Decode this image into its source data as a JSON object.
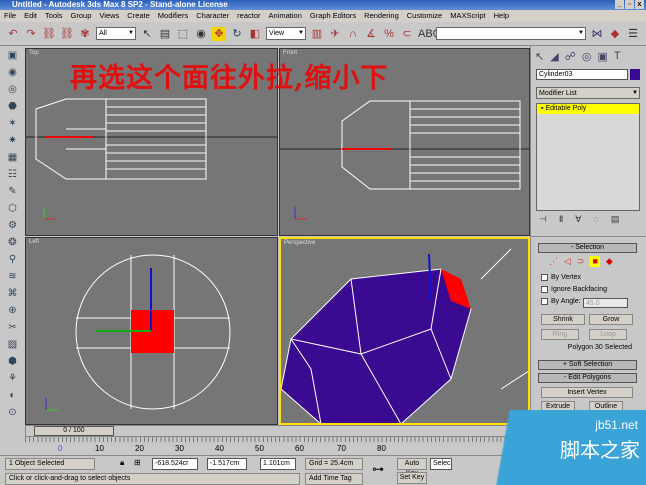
{
  "title": "Untitled - Autodesk 3ds Max 8 SP2  - Stand-alone License",
  "window_controls": [
    "_",
    "▫",
    "x"
  ],
  "menu": [
    "File",
    "Edit",
    "Tools",
    "Group",
    "Views",
    "Create",
    "Modifiers",
    "Character",
    "reactor",
    "Animation",
    "Graph Editors",
    "Rendering",
    "Customize",
    "MAXScript",
    "Help"
  ],
  "toolbar": {
    "selection_filter": "All",
    "ref_coord": "View",
    "named_selection": ""
  },
  "viewports": {
    "top": "Top",
    "front": "Front",
    "left": "Left",
    "perspective": "Perspective"
  },
  "overlay_text": "再选这个面往外拉,缩小下",
  "command_panel": {
    "object_name": "Cylinder03",
    "object_color": "#3a0a90",
    "modifier_list": "Modifier List",
    "stack_item": "Editable Poly",
    "selection": {
      "title": "Selection",
      "by_vertex": "By Vertex",
      "ignore_backfacing": "Ignore Backfacing",
      "by_angle": "By Angle:",
      "angle_value": "45.0",
      "shrink": "Shrink",
      "grow": "Grow",
      "ring": "Ring",
      "loop": "Loop",
      "status": "Polygon 30 Selected"
    },
    "soft_selection": "Soft Selection",
    "edit_polygons": "Edit Polygons",
    "insert_vertex": "Insert Vertex",
    "extrude": "Extrude",
    "outline": "Outline"
  },
  "timeline": {
    "frame": "0 / 100",
    "ticks": [
      "0",
      "10",
      "20",
      "30",
      "40",
      "50",
      "60",
      "70",
      "80"
    ]
  },
  "status": {
    "selected": "1 Object Selected",
    "prompt": "Click or click-and-drag to select objects",
    "x": "-618.524cr",
    "y": "-1.517cm",
    "z": "1.101cm",
    "grid": "Grid = 25.4cm",
    "add_time_tag": "Add Time Tag",
    "auto_key": "Auto Key",
    "set_key": "Set Key",
    "key_filter": "Selec"
  },
  "watermark": {
    "url": "jb51.net",
    "name": "脚本之家"
  }
}
